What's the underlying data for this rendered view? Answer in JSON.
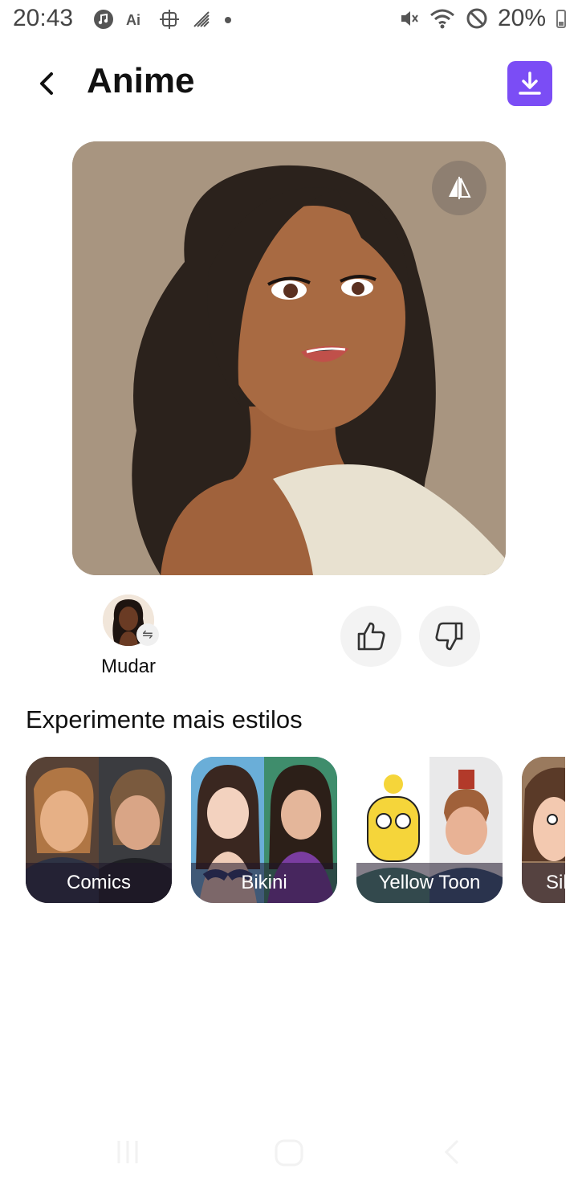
{
  "status_bar": {
    "time": "20:43",
    "battery": "20%",
    "left_icons": [
      "music-icon",
      "ai-icon",
      "crosshair-icon",
      "signal-icon",
      "dot-icon"
    ],
    "right_icons": [
      "mute-icon",
      "wifi-icon",
      "block-icon",
      "battery-icon"
    ]
  },
  "header": {
    "title": "Anime",
    "accent_color": "#7b4df5"
  },
  "main": {
    "change_label": "Mudar"
  },
  "styles": {
    "title": "Experimente mais estilos",
    "items": [
      {
        "label": "Comics"
      },
      {
        "label": "Bikini"
      },
      {
        "label": "Yellow Toon"
      },
      {
        "label": "Sil"
      }
    ]
  }
}
